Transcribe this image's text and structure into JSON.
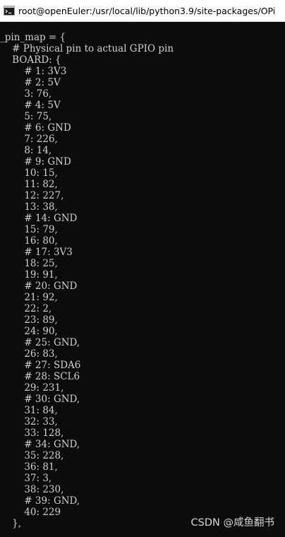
{
  "window": {
    "title": "root@openEuler:/usr/local/lib/python3.9/site-packages/OPi",
    "icon": "terminal-icon"
  },
  "console": {
    "lines": [
      "_pin_map = {",
      "    # Physical pin to actual GPIO pin",
      "    BOARD: {",
      "        # 1: 3V3",
      "        # 2: 5V",
      "        3: 76,",
      "        # 4: 5V",
      "        5: 75,",
      "        # 6: GND",
      "        7: 226,",
      "        8: 14,",
      "        # 9: GND",
      "        10: 15,",
      "        11: 82,",
      "        12: 227,",
      "        13: 38,",
      "        # 14: GND",
      "        15: 79,",
      "        16: 80,",
      "        # 17: 3V3",
      "        18: 25,",
      "        19: 91,",
      "        # 20: GND",
      "        21: 92,",
      "        22: 2,",
      "        23: 89,",
      "        24: 90,",
      "        # 25: GND,",
      "        26: 83,",
      "        # 27: SDA6",
      "        # 28: SCL6",
      "        29: 231,",
      "        # 30: GND,",
      "        31: 84,",
      "        32: 33,",
      "        33: 128,",
      "        # 34: GND,",
      "        35: 228,",
      "        36: 81,",
      "        37: 3,",
      "        38: 230,",
      "        # 39: GND,",
      "        40: 229",
      "    },"
    ]
  },
  "watermark": "CSDN @咸鱼翻书"
}
